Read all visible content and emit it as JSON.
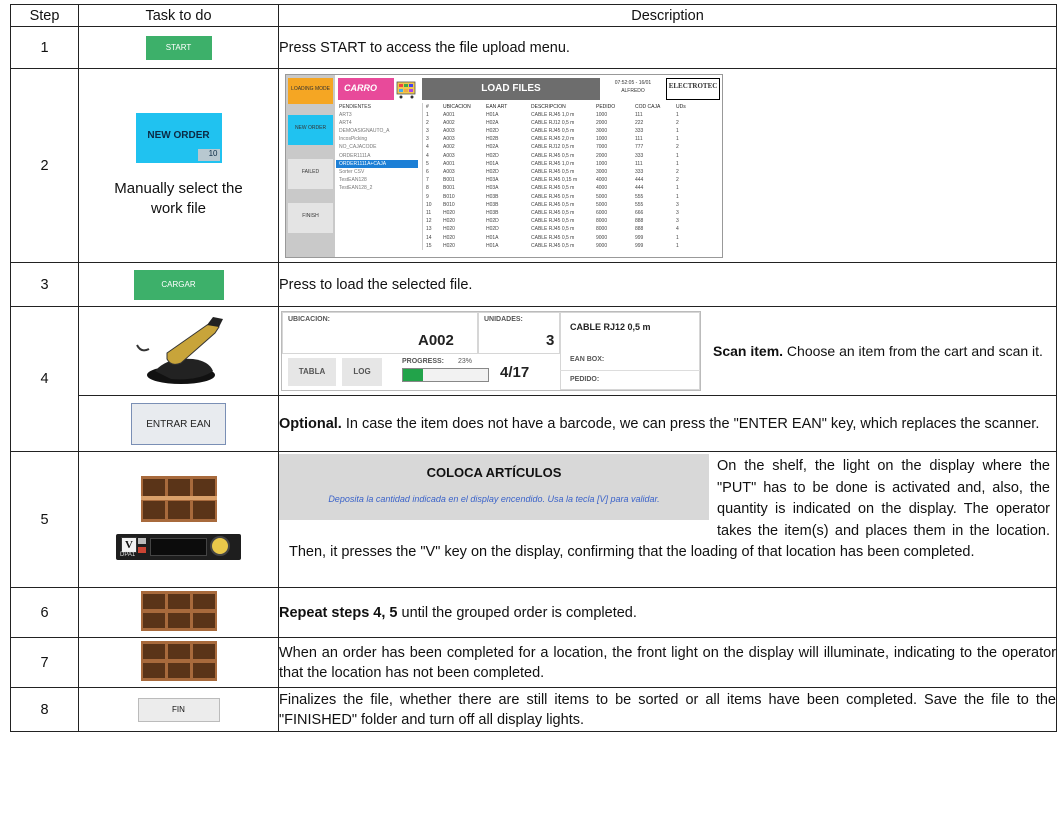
{
  "header": {
    "step": "Step",
    "task": "Task to do",
    "description": "Description"
  },
  "rows": {
    "r1": {
      "step": "1",
      "button": "START",
      "desc": "Press START to access the file upload menu."
    },
    "r2": {
      "step": "2",
      "button_label": "NEW ORDER",
      "button_count": "10",
      "caption": "Manually select the work file",
      "screen": {
        "mode": "LOADING MODE",
        "cart": "CARRO",
        "title": "LOAD FILES",
        "time": "07:52:05 - 16/01",
        "user": "ALFREDO",
        "brand": "ELECTROTEC",
        "side_buttons": [
          "NEW ORDER",
          "FAILED",
          "FINISH"
        ],
        "files_header": "PENDIENTES",
        "files": [
          "ART3",
          "ART4",
          "DEMOASIGNAUTO_A",
          "IncosPicking",
          "NO_CAJACODE",
          "ORDER1111A",
          "ORDER1111A+CAJA",
          "Sorter CSV",
          "TestEAN128",
          "TestEAN128_2"
        ],
        "selected_file": "ORDER1111A+CAJA",
        "columns": [
          "#",
          "UBICACION",
          "EAN ART",
          "DESCRIPCION",
          "PEDIDO",
          "COD CAJA",
          "UDs"
        ],
        "grid": [
          [
            "1",
            "A001",
            "H01A",
            "CABLE RJ45 1,0 m",
            "1000",
            "111",
            "1"
          ],
          [
            "2",
            "A002",
            "H02A",
            "CABLE RJ12 0,5 m",
            "2000",
            "222",
            "2"
          ],
          [
            "3",
            "A003",
            "H02D",
            "CABLE RJ45 0,5 m",
            "3000",
            "333",
            "1"
          ],
          [
            "3",
            "A003",
            "H02B",
            "CABLE RJ45 2,0 m",
            "1000",
            "111",
            "1"
          ],
          [
            "4",
            "A002",
            "H02A",
            "CABLE RJ12 0,5 m",
            "7000",
            "777",
            "2"
          ],
          [
            "4",
            "A003",
            "H02D",
            "CABLE RJ45 0,5 m",
            "2000",
            "333",
            "1"
          ],
          [
            "5",
            "A001",
            "H01A",
            "CABLE RJ45 1,0 m",
            "1000",
            "111",
            "1"
          ],
          [
            "6",
            "A003",
            "H02D",
            "CABLE RJ45 0,5 m",
            "3000",
            "333",
            "2"
          ],
          [
            "7",
            "B001",
            "H03A",
            "CABLE RJ45 0,15 m",
            "4000",
            "444",
            "2"
          ],
          [
            "8",
            "B001",
            "H03A",
            "CABLE RJ45 0,5 m",
            "4000",
            "444",
            "1"
          ],
          [
            "9",
            "B010",
            "H03B",
            "CABLE RJ45 0,5 m",
            "5000",
            "555",
            "1"
          ],
          [
            "10",
            "B010",
            "H03B",
            "CABLE RJ45 0,5 m",
            "5000",
            "555",
            "3"
          ],
          [
            "11",
            "H020",
            "H03B",
            "CABLE RJ45 0,5 m",
            "6000",
            "666",
            "3"
          ],
          [
            "12",
            "H020",
            "H02D",
            "CABLE RJ45 0,5 m",
            "8000",
            "888",
            "3"
          ],
          [
            "13",
            "H020",
            "H02D",
            "CABLE RJ45 0,5 m",
            "8000",
            "888",
            "4"
          ],
          [
            "14",
            "H020",
            "H01A",
            "CABLE RJ45 0,5 m",
            "9000",
            "999",
            "1"
          ],
          [
            "15",
            "H020",
            "H01A",
            "CABLE RJ45 0,5 m",
            "9000",
            "999",
            "1"
          ]
        ]
      }
    },
    "r3": {
      "step": "3",
      "button": "CARGAR",
      "desc": "Press to load the selected file."
    },
    "r4": {
      "step": "4",
      "screen": {
        "ubicacion_label": "UBICACION:",
        "ubicacion": "A002",
        "unidades_label": "UNIDADES:",
        "unidades": "3",
        "item": "CABLE RJ12 0,5 m",
        "tabla": "TABLA",
        "log": "LOG",
        "progress_label": "PROGRESS:",
        "progress_pct": "23%",
        "progress_value": 0.23,
        "count": "4/17",
        "ean_box": "EAN BOX:",
        "pedido": "PEDIDO:"
      },
      "desc_bold": "Scan item.",
      "desc": " Choose an item from the cart and scan it."
    },
    "r4b": {
      "button": "ENTRAR EAN",
      "desc_bold": "Optional.",
      "desc": " In case the item does not have a barcode, we can press the \"ENTER EAN\" key, which replaces the scanner."
    },
    "r5": {
      "step": "5",
      "panel_title": "COLOCA ARTÍCULOS",
      "panel_sub": "Deposita la cantidad indicada en el display encendido. Usa la tecla [V] para validar.",
      "display_key": "V",
      "display_id": "DPA1",
      "desc": "On the shelf, the light on the display where the \"PUT\" has to be done is activated and, also, the quantity is indicated on the display. The operator takes the item(s) and places them in the location. Then, it presses the \"V\" key on the display, confirming that the loading of that location has been completed."
    },
    "r6": {
      "step": "6",
      "desc_bold": "Repeat steps 4, 5",
      "desc": " until the grouped order is completed."
    },
    "r7": {
      "step": "7",
      "desc": "When an order has been completed for a location, the front light on the display will illuminate, indicating to the operator that the location has not been completed."
    },
    "r8": {
      "step": "8",
      "button": "FIN",
      "desc": "Finalizes the file, whether there are still items to be sorted or all items have been completed. Save the file to the \"FINISHED\" folder and turn off all display lights."
    }
  }
}
